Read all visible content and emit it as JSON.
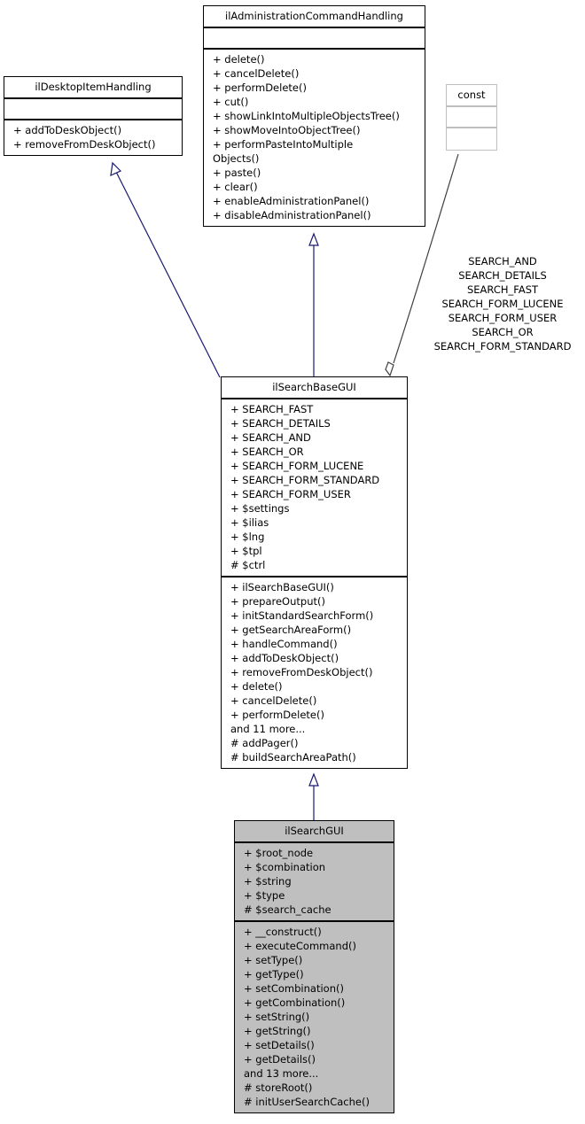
{
  "classes": {
    "desktop_item_handling": {
      "name": "ilDesktopItemHandling",
      "attributes": [],
      "methods": [
        "+ addToDeskObject()",
        "+ removeFromDeskObject()"
      ]
    },
    "administration_command_handling": {
      "name": "ilAdministrationCommandHandling",
      "attributes": [],
      "methods": [
        "+ delete()",
        "+ cancelDelete()",
        "+ performDelete()",
        "+ cut()",
        "+ showLinkIntoMultipleObjectsTree()",
        "+ showMoveIntoObjectTree()",
        "+ performPasteIntoMultiple",
        "Objects()",
        "+ paste()",
        "+ clear()",
        "+ enableAdministrationPanel()",
        "+ disableAdministrationPanel()"
      ]
    },
    "const": {
      "name": "const",
      "attributes": [],
      "methods": []
    },
    "search_base_gui": {
      "name": "ilSearchBaseGUI",
      "attributes": [
        "+ SEARCH_FAST",
        "+ SEARCH_DETAILS",
        "+ SEARCH_AND",
        "+ SEARCH_OR",
        "+ SEARCH_FORM_LUCENE",
        "+ SEARCH_FORM_STANDARD",
        "+ SEARCH_FORM_USER",
        "+ $settings",
        "+ $ilias",
        "+ $lng",
        "+ $tpl",
        "# $ctrl"
      ],
      "methods": [
        "+ ilSearchBaseGUI()",
        "+ prepareOutput()",
        "+ initStandardSearchForm()",
        "+ getSearchAreaForm()",
        "+ handleCommand()",
        "+ addToDeskObject()",
        "+ removeFromDeskObject()",
        "+ delete()",
        "+ cancelDelete()",
        "+ performDelete()",
        "and 11 more...",
        "# addPager()",
        "# buildSearchAreaPath()"
      ]
    },
    "search_gui": {
      "name": "ilSearchGUI",
      "attributes": [
        "+ $root_node",
        "+ $combination",
        "+ $string",
        "+ $type",
        "# $search_cache"
      ],
      "methods": [
        "+ __construct()",
        "+ executeCommand()",
        "+ setType()",
        "+ getType()",
        "+ setCombination()",
        "+ getCombination()",
        "+ setString()",
        "+ getString()",
        "+ setDetails()",
        "+ getDetails()",
        "and 13 more...",
        "# storeRoot()",
        "# initUserSearchCache()"
      ]
    }
  },
  "edges": {
    "const_usage_label": [
      "SEARCH_AND",
      "SEARCH_DETAILS",
      "SEARCH_FAST",
      "SEARCH_FORM_LUCENE",
      "SEARCH_FORM_USER",
      "SEARCH_OR",
      "SEARCH_FORM_STANDARD"
    ]
  },
  "colors": {
    "inheritance_edge": "#191970",
    "usage_edge": "#404040",
    "focus_class_fill": "#bfbfbf",
    "external_class_border": "#bfbfbf"
  }
}
